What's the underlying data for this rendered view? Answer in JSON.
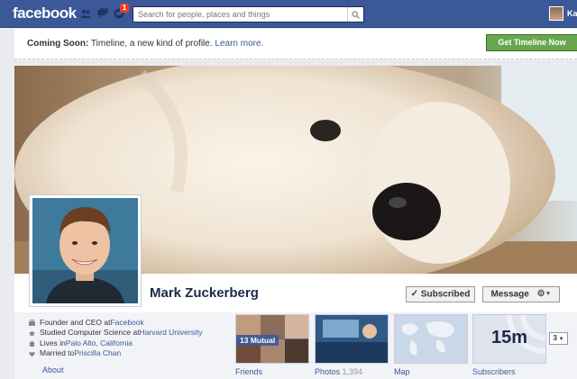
{
  "topbar": {
    "logo": "facebook",
    "notification_count": "1",
    "search_placeholder": "Search for people, places and things",
    "user_initials": "Ka",
    "icons": [
      "friend-requests-icon",
      "messages-icon",
      "notifications-icon",
      "search-icon"
    ],
    "color": "#3b5998"
  },
  "coming_soon": {
    "label": "Coming Soon:",
    "text": " Timeline, a new kind of profile. ",
    "link": "Learn more.",
    "button": "Get Timeline Now",
    "button_color": "#69a74e"
  },
  "profile": {
    "name": "Mark Zuckerberg",
    "subscribed_label": "Subscribed",
    "message_label": "Message"
  },
  "info": {
    "lines": [
      {
        "prefix": "Founder and CEO at ",
        "link": "Facebook",
        "suffix": "",
        "icon": "briefcase-icon"
      },
      {
        "prefix": "Studied Computer Science at ",
        "link": "Harvard University",
        "suffix": "",
        "icon": "education-icon"
      },
      {
        "prefix": "Lives in ",
        "link": "Palo Alto, California",
        "suffix": "",
        "icon": "home-icon"
      },
      {
        "prefix": "Married to ",
        "link": "Priscilla Chan",
        "suffix": "",
        "icon": "heart-icon"
      }
    ],
    "about": "About"
  },
  "tiles": {
    "friends_label": "Friends",
    "mutual": "13 Mutual",
    "photos_label": "Photos",
    "photos_count": "1,394",
    "map_label": "Map",
    "subscribers_label": "Subscribers",
    "subscribers_count": "15m",
    "more_count": "3"
  }
}
